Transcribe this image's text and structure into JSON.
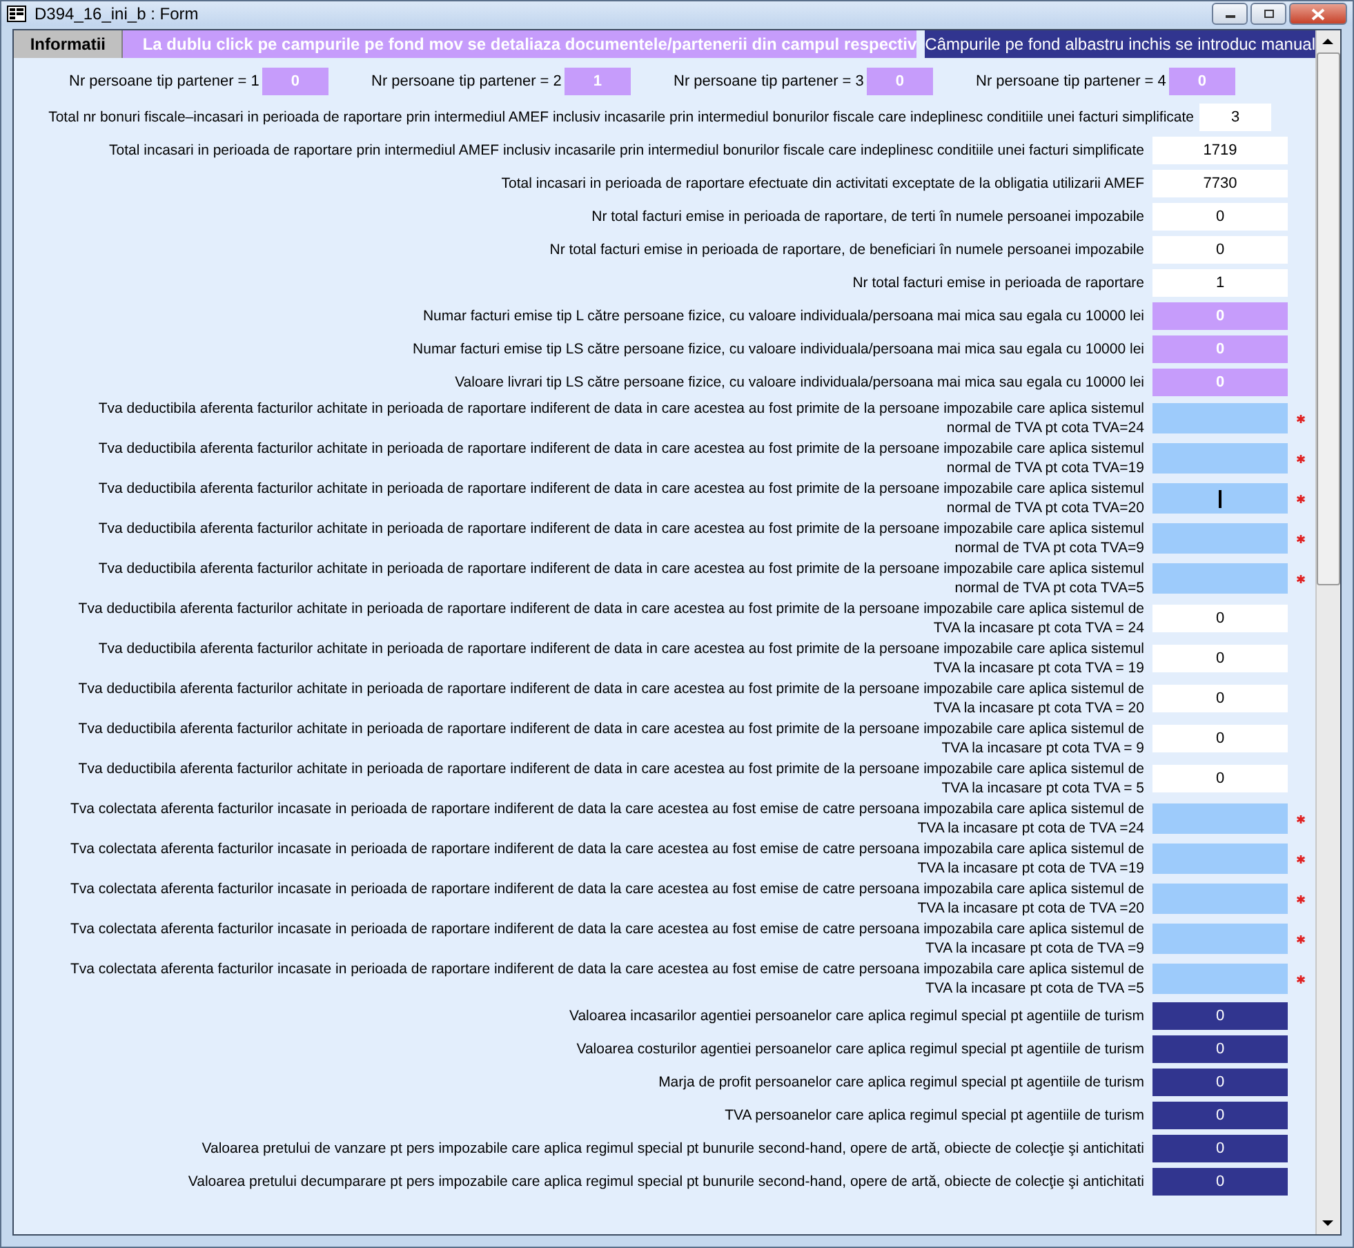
{
  "window": {
    "title": "D394_16_ini_b : Form"
  },
  "header": {
    "tab": "Informatii",
    "purple_note": "La dublu click pe campurile pe fond mov se detaliaza documentele/partenerii din  campul respectiv",
    "blue_note": "Câmpurile pe fond albastru inchis se introduc manual"
  },
  "partners": [
    {
      "label": "Nr persoane tip partener = 1",
      "value": "0"
    },
    {
      "label": "Nr persoane tip partener = 2",
      "value": "1"
    },
    {
      "label": "Nr persoane tip partener = 3",
      "value": "0"
    },
    {
      "label": "Nr persoane tip partener = 4",
      "value": "0"
    }
  ],
  "rows": [
    {
      "label": "Total nr bonuri fiscale–incasari in perioada de raportare prin intermediul AMEF inclusiv incasarile prin intermediul bonurilor fiscale care indeplinesc conditiile unei facturi simplificate",
      "kind": "narrow",
      "value": "3",
      "required": false
    },
    {
      "label": "Total incasari in perioada de raportare prin intermediul AMEF inclusiv incasarile prin intermediul bonurilor fiscale care indeplinesc conditiile unei facturi simplificate",
      "kind": "white",
      "value": "1719",
      "required": false
    },
    {
      "label": "Total incasari in perioada de raportare efectuate din activitati exceptate de la obligatia utilizarii AMEF",
      "kind": "white",
      "value": "7730",
      "required": false
    },
    {
      "label": "Nr total facturi emise in perioada de raportare, de terti în numele persoanei impozabile",
      "kind": "white",
      "value": "0",
      "required": false
    },
    {
      "label": "Nr total facturi emise in perioada de raportare, de beneficiari în numele persoanei impozabile",
      "kind": "white",
      "value": "0",
      "required": false
    },
    {
      "label": "Nr total facturi emise in perioada de raportare",
      "kind": "white",
      "value": "1",
      "required": false
    },
    {
      "label": "Numar facturi emise tip L către persoane fizice, cu valoare individuala/persoana mai mica sau egala cu 10000 lei",
      "kind": "purple",
      "value": "0",
      "required": false
    },
    {
      "label": "Numar facturi emise tip LS către persoane fizice, cu valoare individuala/persoana mai mica sau egala cu 10000 lei",
      "kind": "purple",
      "value": "0",
      "required": false
    },
    {
      "label": "Valoare livrari tip LS către persoane fizice, cu valoare individuala/persoana mai mica sau egala cu 10000 lei",
      "kind": "purple",
      "value": "0",
      "required": false
    },
    {
      "label": "Tva deductibila aferenta facturilor achitate in perioada de raportare indiferent de data in care acestea au fost primite de la persoane impozabile care aplica sistemul\nnormal de TVA pt cota TVA=24",
      "kind": "light",
      "required": true,
      "focused": false
    },
    {
      "label": "Tva deductibila aferenta facturilor achitate in perioada de raportare indiferent de data in care acestea au fost primite de la persoane impozabile care aplica sistemul\nnormal de TVA pt cota TVA=19",
      "kind": "light",
      "required": true,
      "focused": false
    },
    {
      "label": "Tva deductibila aferenta facturilor achitate in perioada de raportare indiferent de data in care acestea au fost primite de la persoane impozabile care aplica sistemul\nnormal de TVA pt cota TVA=20",
      "kind": "light",
      "required": true,
      "focused": true
    },
    {
      "label": "Tva deductibila aferenta facturilor achitate in perioada de raportare indiferent de data in care acestea au fost primite de la persoane impozabile care aplica sistemul\nnormal de TVA pt cota TVA=9",
      "kind": "light",
      "required": true,
      "focused": false
    },
    {
      "label": "Tva deductibila aferenta facturilor achitate in perioada de raportare indiferent de data in care acestea au fost primite de la persoane impozabile care aplica sistemul\nnormal de TVA pt cota TVA=5",
      "kind": "light",
      "required": true,
      "focused": false
    },
    {
      "label": "Tva deductibila aferenta facturilor achitate in perioada de raportare indiferent de data in care acestea au fost primite de la persoane impozabile care aplica sistemul de\nTVA la incasare pt cota TVA = 24",
      "kind": "white",
      "value": "0",
      "required": false
    },
    {
      "label": "Tva deductibila aferenta facturilor achitate in perioada de raportare indiferent de data in care acestea au fost primite de la persoane impozabile care aplica sistemul\nTVA la incasare pt cota TVA = 19",
      "kind": "white",
      "value": "0",
      "required": false
    },
    {
      "label": "Tva deductibila aferenta facturilor achitate in perioada de raportare indiferent de data in care acestea au fost primite de la persoane impozabile care aplica sistemul de\nTVA la incasare pt cota TVA = 20",
      "kind": "white",
      "value": "0",
      "required": false
    },
    {
      "label": "Tva deductibila aferenta facturilor achitate in perioada de raportare indiferent de data in care acestea au fost primite de la persoane impozabile care aplica sistemul de\nTVA la incasare pt cota TVA = 9",
      "kind": "white",
      "value": "0",
      "required": false
    },
    {
      "label": "Tva deductibila aferenta facturilor achitate in perioada de raportare indiferent de data in care acestea au fost primite de la persoane impozabile care aplica sistemul de\nTVA la incasare pt cota TVA = 5",
      "kind": "white",
      "value": "0",
      "required": false
    },
    {
      "label": "Tva colectata aferenta facturilor incasate in perioada de raportare indiferent de data la care acestea au fost emise de catre persoana impozabila care aplica sistemul de\nTVA la incasare pt cota de TVA =24",
      "kind": "light",
      "required": true,
      "focused": false
    },
    {
      "label": "Tva colectata aferenta facturilor incasate in perioada de raportare indiferent de data la care acestea au fost emise de catre persoana impozabila care aplica sistemul de\nTVA la incasare pt cota de TVA =19",
      "kind": "light",
      "required": true,
      "focused": false
    },
    {
      "label": "Tva colectata aferenta facturilor incasate in perioada de raportare indiferent de data la care acestea au fost emise de catre persoana impozabila care aplica sistemul de\nTVA la incasare pt cota de TVA =20",
      "kind": "light",
      "required": true,
      "focused": false
    },
    {
      "label": "Tva colectata aferenta facturilor incasate in perioada de raportare indiferent de data la care acestea au fost emise de catre persoana impozabila care aplica sistemul de\nTVA la incasare pt cota de TVA =9",
      "kind": "light",
      "required": true,
      "focused": false
    },
    {
      "label": "Tva colectata aferenta facturilor incasate in perioada de raportare indiferent de data la care acestea au fost emise de catre persoana impozabila care aplica sistemul de\nTVA la incasare pt cota de TVA =5",
      "kind": "light",
      "required": true,
      "focused": false
    },
    {
      "label": "Valoarea incasarilor agentiei persoanelor care aplica regimul special pt agentiile de turism",
      "kind": "dark",
      "value": "0",
      "required": false
    },
    {
      "label": "Valoarea costurilor agentiei persoanelor care aplica regimul special pt agentiile de turism",
      "kind": "dark",
      "value": "0",
      "required": false
    },
    {
      "label": "Marja de profit persoanelor care aplica regimul special pt agentiile de turism",
      "kind": "dark",
      "value": "0",
      "required": false
    },
    {
      "label": "TVA persoanelor care aplica regimul special pt agentiile de turism",
      "kind": "dark",
      "value": "0",
      "required": false
    },
    {
      "label": "Valoarea pretului de vanzare pt pers impozabile care aplica regimul special pt bunurile second-hand, opere de artă, obiecte de colecţie şi antichitati",
      "kind": "dark",
      "value": "0",
      "required": false
    },
    {
      "label": "Valoarea pretului decumparare pt pers impozabile care aplica regimul special pt bunurile second-hand, opere de artă, obiecte de colecţie şi antichitati",
      "kind": "dark",
      "value": "0",
      "required": false
    }
  ]
}
